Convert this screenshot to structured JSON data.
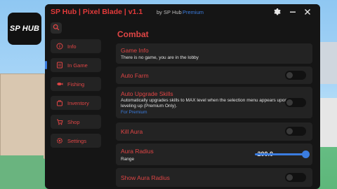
{
  "logo": {
    "text": "SP HUB"
  },
  "window": {
    "title": "SP Hub | Pixel Blade | v1.1",
    "by": "by SP Hub",
    "premium": "Premium",
    "icons": [
      "gear-icon",
      "minimize-icon",
      "close-icon"
    ]
  },
  "sidebar": {
    "search_icon": "search-icon",
    "items": [
      {
        "label": "Info",
        "icon": "info-icon"
      },
      {
        "label": "In Game",
        "icon": "in-game-icon"
      },
      {
        "label": "Fishing",
        "icon": "fishing-icon"
      },
      {
        "label": "Inventory",
        "icon": "inventory-icon"
      },
      {
        "label": "Shop",
        "icon": "shop-icon"
      },
      {
        "label": "Settings",
        "icon": "settings-icon"
      }
    ],
    "active_index": 1
  },
  "main": {
    "section_title": "Combat",
    "game_info": {
      "title": "Game Info",
      "desc": "There is no game, you are in the lobby"
    },
    "auto_farm": {
      "title": "Auto Farm",
      "enabled": false
    },
    "auto_upgrade": {
      "title": "Auto Upgrade Skills",
      "desc": "Automatically upgrades skills to MAX level when the selection menu appears upon leveling up (Premium Only).",
      "link": "For Premium",
      "enabled": false
    },
    "kill_aura": {
      "title": "Kill Aura",
      "enabled": false
    },
    "aura_radius": {
      "title": "Aura Radius",
      "sub": "Range",
      "value": "200.0",
      "fraction": 1.0
    },
    "show_aura_radius": {
      "title": "Show Aura Radius",
      "enabled": false
    }
  },
  "colors": {
    "accent_red": "#e04545",
    "accent_blue": "#3b7de0",
    "panel": "#151515",
    "card": "#232323"
  }
}
